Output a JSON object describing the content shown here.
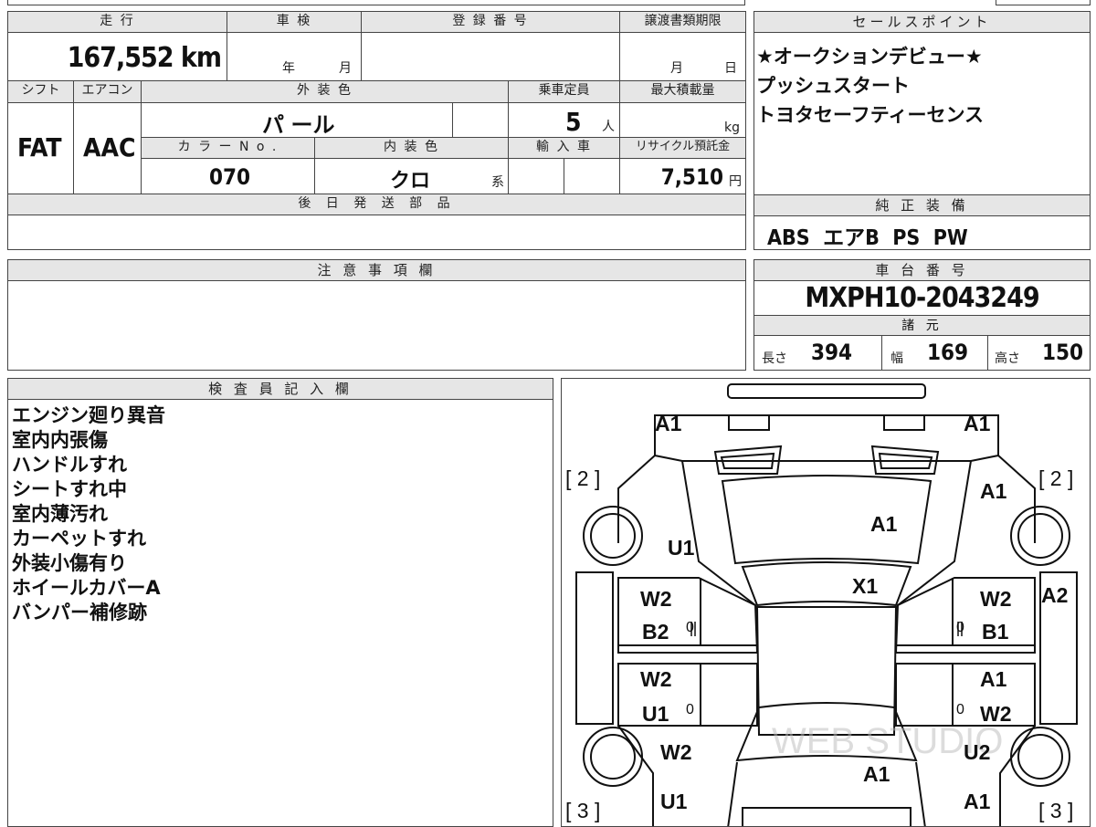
{
  "spec": {
    "mileage_label": "走 行",
    "mileage_value": "167,552 km",
    "inspection_label": "車 検",
    "inspection_year": "年",
    "inspection_month": "月",
    "registration_label": "登 録 番 号",
    "transfer_label": "譲渡書類期限",
    "transfer_month": "月",
    "transfer_day": "日",
    "shift_label": "シフト",
    "shift_value": "FAT",
    "aircon_label": "エアコン",
    "aircon_value": "AAC",
    "exterior_label": "外 装 色",
    "exterior_value": "パ ール",
    "capacity_label": "乗車定員",
    "capacity_value": "5",
    "capacity_unit": "人",
    "maxload_label": "最大積載量",
    "maxload_unit": "kg",
    "color_no_label": "カ ラ ー N o .",
    "color_no_value": "070",
    "interior_label": "内 装 色",
    "interior_value": "クロ",
    "interior_unit": "系",
    "import_label": "輸 入 車",
    "recycle_label": "リサイクル預託金",
    "recycle_value": "7,510",
    "recycle_unit": "円",
    "later_parts_label": "後 日 発 送 部 品"
  },
  "sales": {
    "header": "セールスポイント",
    "lines": [
      "★オークションデビュー★",
      "プッシュスタート",
      "トヨタセーフティーセンス"
    ]
  },
  "equipment": {
    "header": "純 正 装 備",
    "value": "ABS  エアB  PS  PW"
  },
  "notes": {
    "header": "注 意 事 項 欄"
  },
  "chassis": {
    "header": "車 台 番 号",
    "value": "MXPH10-2043249",
    "specs_header": "諸 元",
    "length_label": "長さ",
    "length_value": "394",
    "width_label": "幅",
    "width_value": "169",
    "height_label": "高さ",
    "height_value": "150"
  },
  "inspector": {
    "header": "検 査 員 記 入 欄",
    "lines": [
      "エンジン廻り異音",
      "室内内張傷",
      "ハンドルすれ",
      "シートすれ中",
      "室内薄汚れ",
      "カーペットすれ",
      "外装小傷有り",
      "ホイールカバーA",
      "バンパー補修跡"
    ]
  },
  "diagram": {
    "marks": {
      "front_left": "A1",
      "front_right": "A1",
      "wheel_fl": "[ 2 ]",
      "wheel_fr": "[ 2 ]",
      "fender_r": "A1",
      "hood": "A1",
      "fender_l": "U1",
      "windshield": "X1",
      "door_fl_1": "W2",
      "door_fl_2": "B2",
      "door_fr_1": "W2",
      "door_fr_2": "B1",
      "pillar_r": "A2",
      "door_rl_1": "W2",
      "door_rl_2": "U1",
      "door_rr_1": "A1",
      "door_rr_2": "W2",
      "rear_l_1": "W2",
      "rear_r_1": "U2",
      "roof_rear": "A1",
      "rear_l_2": "U1",
      "rear_r_2": "A1",
      "wheel_rl": "[ 3 ]",
      "wheel_rr": "[ 3 ]",
      "zero": "0"
    }
  }
}
